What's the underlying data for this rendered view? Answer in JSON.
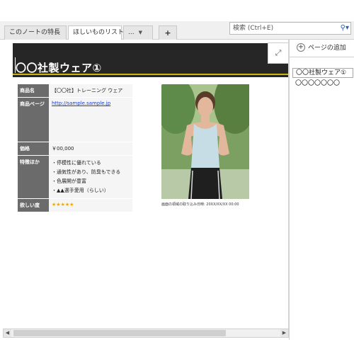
{
  "tabs": [
    {
      "label": "このノートの特長"
    },
    {
      "label": "ほしいものリスト"
    },
    {
      "label": "..."
    }
  ],
  "new_tab_label": "+",
  "search": {
    "placeholder": "検索 (Ctrl+E)",
    "icon": "magnifier-icon"
  },
  "page": {
    "title": "〇〇社製ウェア①",
    "fields": {
      "name_label": "商品名",
      "name_value": "【〇〇社】トレーニング ウェア",
      "page_label": "商品ページ",
      "page_value": "http://sample.sample.jp",
      "price_label": "価格",
      "price_value": "￥00,000",
      "features_label": "特徴ほか",
      "features": [
        "・停模性に優れている",
        "・通気性があり、防臭もできる",
        "・色展開が豊富",
        "・▲▲選手愛用（らしい）"
      ],
      "want_label": "欲しい度",
      "want_value": "★★★★★"
    },
    "image_caption": "画面の領域の取り込み日時: 20XX/XX/XX 00:00"
  },
  "right_pane": {
    "add_page_label": "ページの追加",
    "pages": [
      "〇〇社製ウェア①",
      "〇〇〇〇〇〇〇"
    ]
  },
  "colors": {
    "header": "#262626",
    "accent_line": "#c8b418",
    "label_bg": "#6b6b6b",
    "stars": "#f0a800"
  }
}
